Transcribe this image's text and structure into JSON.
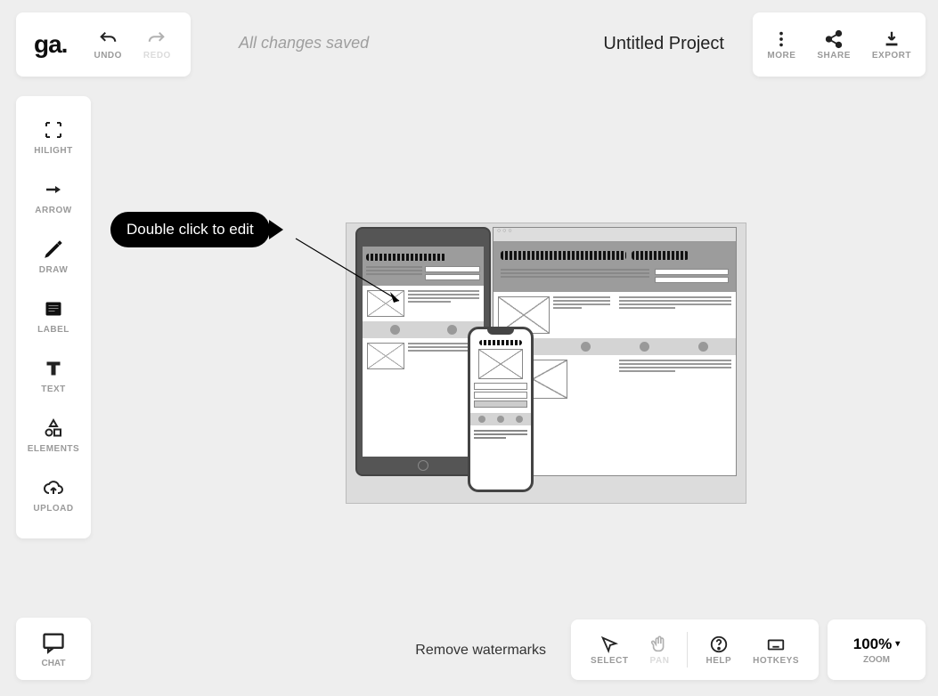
{
  "header": {
    "logo_text": "ga.",
    "undo_label": "UNDO",
    "redo_label": "REDO",
    "save_status": "All changes saved",
    "project_title": "Untitled Project",
    "more_label": "MORE",
    "share_label": "SHARE",
    "export_label": "EXPORT"
  },
  "sidebar": {
    "tools": [
      {
        "label": "HILIGHT",
        "icon": "highlight-icon"
      },
      {
        "label": "ARROW",
        "icon": "arrow-icon"
      },
      {
        "label": "DRAW",
        "icon": "pencil-icon"
      },
      {
        "label": "LABEL",
        "icon": "label-icon"
      },
      {
        "label": "TEXT",
        "icon": "text-icon"
      },
      {
        "label": "ELEMENTS",
        "icon": "shapes-icon"
      },
      {
        "label": "UPLOAD",
        "icon": "cloud-upload-icon"
      }
    ]
  },
  "chat": {
    "label": "CHAT"
  },
  "canvas": {
    "tooltip_text": "Double click to edit"
  },
  "footer": {
    "watermark_link": "Remove watermarks",
    "select_label": "SELECT",
    "pan_label": "PAN",
    "help_label": "HELP",
    "hotkeys_label": "HOTKEYS",
    "zoom_value": "100%",
    "zoom_label": "ZOOM"
  }
}
